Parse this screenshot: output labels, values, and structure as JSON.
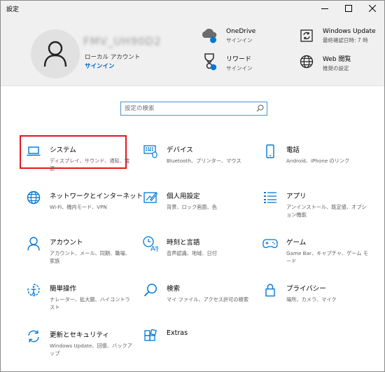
{
  "window": {
    "title": "設定"
  },
  "account": {
    "username": "FMV_UH90D2",
    "type": "ローカル アカウント",
    "signin": "サインイン"
  },
  "header_items": [
    {
      "title": "OneDrive",
      "sub": "サインイン",
      "icon": "cloud-icon"
    },
    {
      "title": "リワード",
      "sub": "サインイン",
      "icon": "rewards-trophy-icon"
    },
    {
      "title": "Windows Update",
      "sub": "最終確認日時: 7 時",
      "icon": "update-refresh-icon"
    },
    {
      "title": "Web 閲覧",
      "sub": "推奨の設定",
      "icon": "globe-icon"
    }
  ],
  "search": {
    "placeholder": "設定の検索",
    "icon": "search-icon"
  },
  "tiles": [
    {
      "title": "システム",
      "desc": "ディスプレイ、サウンド、通知、電源",
      "icon": "laptop-icon"
    },
    {
      "title": "デバイス",
      "desc": "Bluetooth、プリンター、マウス",
      "icon": "keyboard-icon"
    },
    {
      "title": "電話",
      "desc": "Android、iPhone のリンク",
      "icon": "phone-icon"
    },
    {
      "title": "ネットワークとインターネット",
      "desc": "Wi-Fi、機内モード、VPN",
      "icon": "globe-icon"
    },
    {
      "title": "個人用設定",
      "desc": "背景、ロック画面、色",
      "icon": "personalization-icon"
    },
    {
      "title": "アプリ",
      "desc": "アンインストール、既定値、オプション機能",
      "icon": "apps-list-icon"
    },
    {
      "title": "アカウント",
      "desc": "アカウント、メール、同期、職場、家族",
      "icon": "person-icon"
    },
    {
      "title": "時刻と言語",
      "desc": "音声認識、地域、日付",
      "icon": "time-language-icon"
    },
    {
      "title": "ゲーム",
      "desc": "Game Bar、キャプチャ、ゲーム モード",
      "icon": "gamepad-icon"
    },
    {
      "title": "簡単操作",
      "desc": "ナレーター、拡大鏡、ハイコントラスト",
      "icon": "ease-of-access-icon"
    },
    {
      "title": "検索",
      "desc": "マイ ファイル、アクセス許可の検索",
      "icon": "search-icon"
    },
    {
      "title": "プライバシー",
      "desc": "場所、カメラ、マイク",
      "icon": "lock-icon"
    },
    {
      "title": "更新とセキュリティ",
      "desc": "Windows Update、回復、バックアップ",
      "icon": "update-sync-icon"
    },
    {
      "title": "Extras",
      "desc": "",
      "icon": "extras-grid-icon"
    }
  ],
  "colors": {
    "accent": "#0067c0",
    "icon_blue": "#0078d7",
    "highlight": "#e8141c",
    "header_bg": "#f0f0f0"
  }
}
